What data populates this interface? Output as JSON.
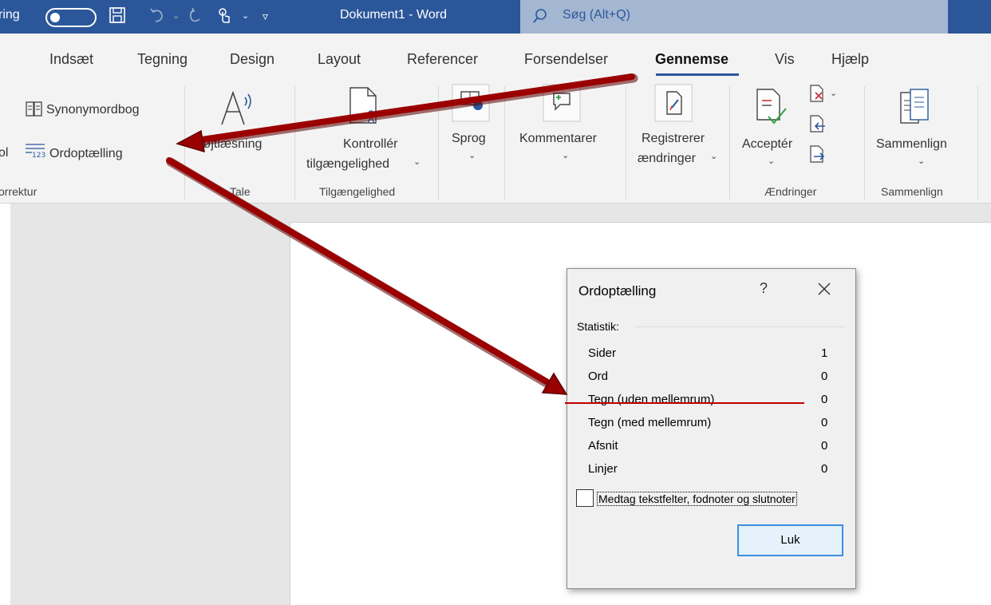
{
  "titlebar": {
    "autosave_partial": "ring",
    "document_title": "Dokument1 - Word",
    "search_placeholder": "Søg (Alt+Q)"
  },
  "tabs": [
    {
      "label": "Indsæt"
    },
    {
      "label": "Tegning"
    },
    {
      "label": "Design"
    },
    {
      "label": "Layout"
    },
    {
      "label": "Referencer"
    },
    {
      "label": "Forsendelser"
    },
    {
      "label": "Gennemse",
      "active": true
    },
    {
      "label": "Vis"
    },
    {
      "label": "Hjælp"
    }
  ],
  "ribbon": {
    "synonymordbog": "Synonymordbog",
    "ordoptaelling": "Ordoptælling",
    "cut_left_glyph": "ol",
    "group_korrektur": "orrektur",
    "hojtlaesning": "Højtlæsning",
    "group_tale": "Tale",
    "kontroller_line1": "Kontrollér",
    "kontroller_line2": "tilgængelighed",
    "group_tilgaengelighed": "Tilgængelighed",
    "sprog": "Sprog",
    "kommentarer": "Kommentarer",
    "registrerer_line1": "Registrerer",
    "registrerer_line2": "ændringer",
    "accepter": "Acceptér",
    "group_aendringer": "Ændringer",
    "sammenlign": "Sammenlign",
    "group_sammenlign": "Sammenlign",
    "caret": "⌄",
    "wc_glyph": "123"
  },
  "dialog": {
    "title": "Ordoptælling",
    "help": "?",
    "group_label": "Statistik:",
    "stats": [
      {
        "label": "Sider",
        "value": "1"
      },
      {
        "label": "Ord",
        "value": "0"
      },
      {
        "label": "Tegn (uden mellemrum)",
        "value": "0"
      },
      {
        "label": "Tegn (med mellemrum)",
        "value": "0"
      },
      {
        "label": "Afsnit",
        "value": "0"
      },
      {
        "label": "Linjer",
        "value": "0"
      }
    ],
    "checkbox_label": "Medtag tekstfelter, fodnoter og slutnoter",
    "checkbox_checked": false,
    "close_button": "Luk"
  },
  "colors": {
    "titlebar": "#2b579a",
    "annotation_arrow": "#9b0000",
    "strike_line": "#c00000"
  }
}
